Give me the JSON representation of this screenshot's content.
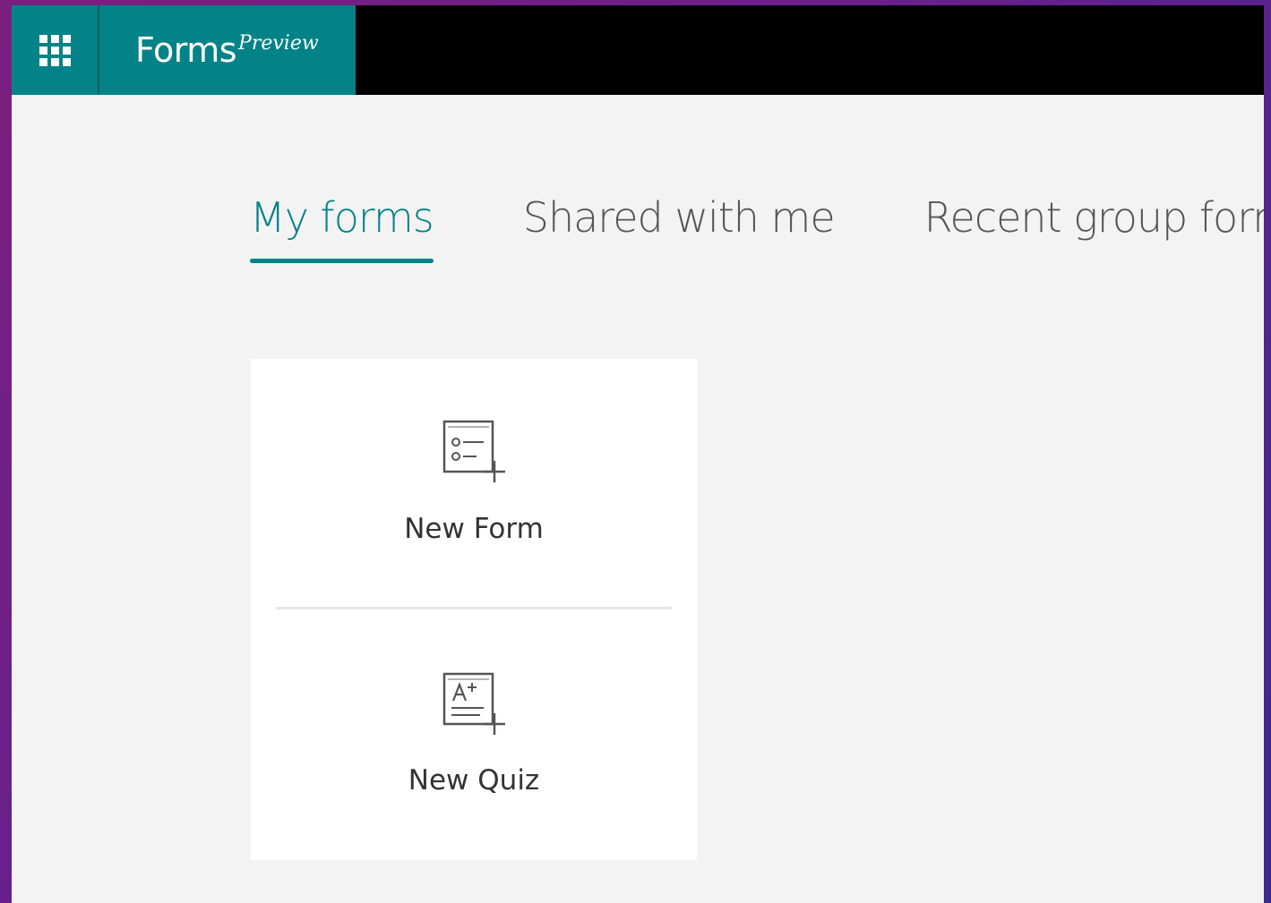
{
  "header": {
    "app_name": "Forms",
    "app_tag": "Preview",
    "waffle_icon": "app-launcher-icon"
  },
  "tabs": [
    {
      "label": "My forms",
      "active": true
    },
    {
      "label": "Shared with me",
      "active": false
    },
    {
      "label": "Recent group forms",
      "active": false
    }
  ],
  "create_card": {
    "new_form_label": "New Form",
    "new_form_icon": "new-form-icon",
    "new_quiz_label": "New Quiz",
    "new_quiz_icon": "new-quiz-icon"
  },
  "colors": {
    "accent": "#038387",
    "topbar": "#000000",
    "page_background": "#f3f3f3"
  }
}
